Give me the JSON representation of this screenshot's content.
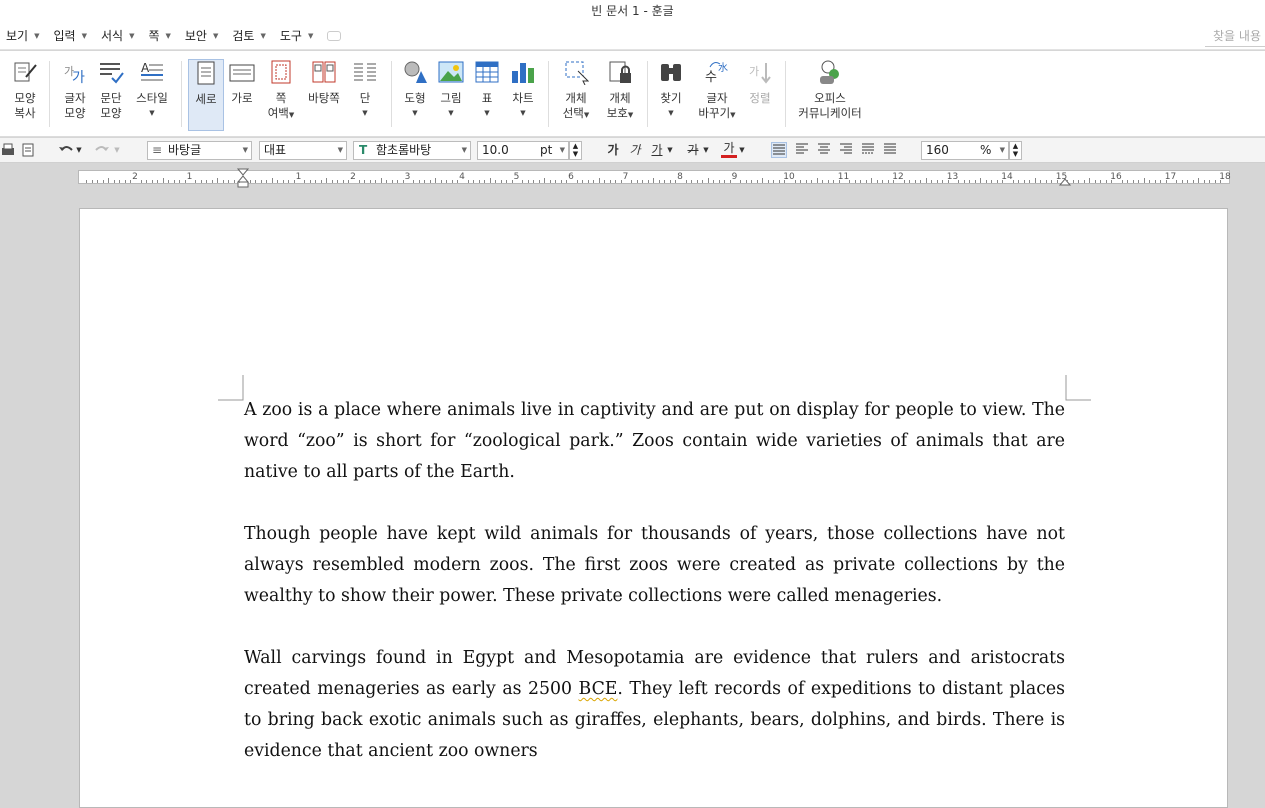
{
  "window": {
    "title": "빈 문서 1 - 훈글"
  },
  "menubar": {
    "items": [
      "보기",
      "입력",
      "서식",
      "쪽",
      "보안",
      "검토",
      "도구"
    ],
    "find_placeholder": "찾을 내용"
  },
  "ribbon": {
    "shape_copy": [
      "모양",
      "복사"
    ],
    "char_shape": [
      "글자",
      "모양"
    ],
    "para_shape": [
      "문단",
      "모양"
    ],
    "style": "스타일",
    "portrait": "세로",
    "landscape": "가로",
    "page_margin": [
      "쪽",
      "여백"
    ],
    "master_page": "바탕쪽",
    "column": "단",
    "shape": "도형",
    "picture": "그림",
    "table": "표",
    "chart": "차트",
    "object_select": [
      "개체",
      "선택"
    ],
    "object_protect": [
      "개체",
      "보호"
    ],
    "find": "찾기",
    "replace": [
      "글자",
      "바꾸기"
    ],
    "sort": "정렬",
    "office_communicator": [
      "오피스",
      "커뮤니케이터"
    ]
  },
  "format": {
    "style_value": "바탕글",
    "lang_value": "대표",
    "font_value": "함초롬바탕",
    "size_value": "10.0",
    "size_unit": "pt",
    "bold": "가",
    "italic": "가",
    "underline": "가",
    "strike": "가",
    "color_char": "가",
    "zoom_value": "160",
    "zoom_unit": "%"
  },
  "ruler": {
    "labels": [
      "2",
      "1",
      "1",
      "2",
      "3",
      "4",
      "5",
      "6",
      "7",
      "8",
      "9",
      "10",
      "11",
      "12",
      "13",
      "14",
      "15",
      "16",
      "17",
      "18"
    ]
  },
  "document": {
    "paragraphs": [
      "A zoo is a place where animals live in captivity and are put on display for people to view. The word “zoo” is short for “zoological park.” Zoos contain wide varieties of animals that are native to all parts of the Earth.",
      "Though people have kept wild animals for thousands of years, those collections have not always resembled modern zoos. The first zoos were created as private collections by the wealthy to show their power. These private collections were called menageries."
    ],
    "p3_before": "Wall carvings found in Egypt and Mesopotamia are evidence that rulers and aristocrats created menageries as early as 2500 ",
    "p3_marked": "BCE",
    "p3_after": ". They left records of expeditions to distant places to bring back exotic animals such as giraffes, elephants, bears, dolphins, and birds. There is evidence that ancient zoo owners"
  },
  "colors": {
    "accent_blue": "#2f6fc4",
    "active_bg": "#dfe9f6",
    "page_bg": "#ffffff",
    "workspace": "#d6d6d6"
  }
}
